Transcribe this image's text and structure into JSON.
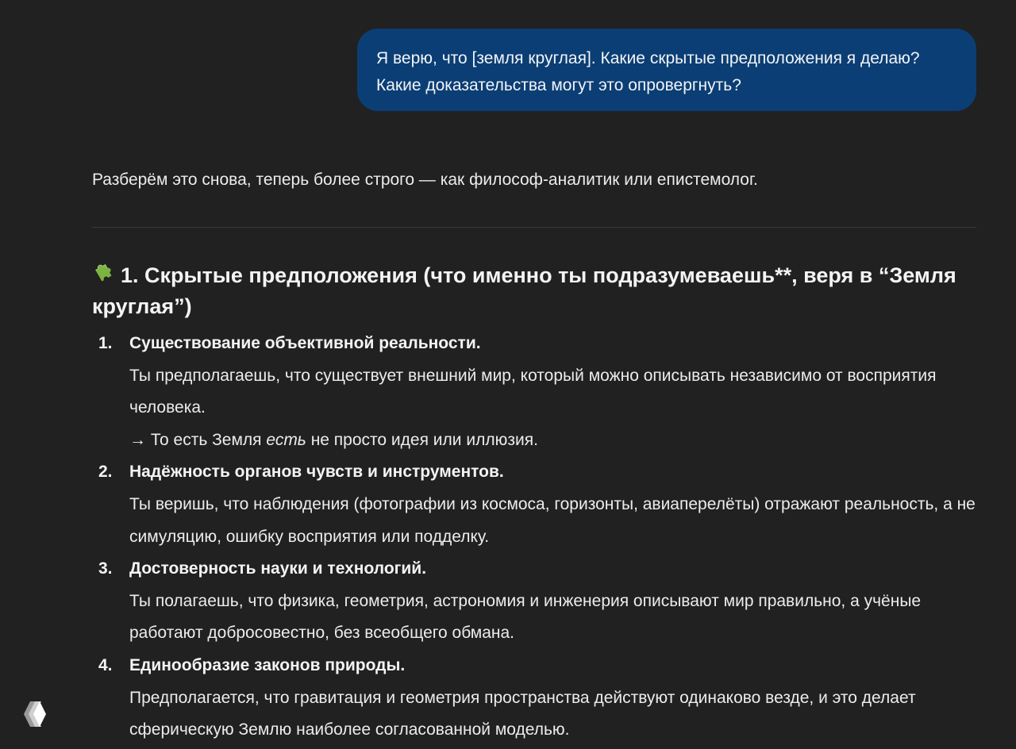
{
  "user_message": {
    "text": "Я верю, что [земля круглая]. Какие скрытые предположения я делаю? Какие доказательства могут это опровергнуть?"
  },
  "assistant": {
    "intro": "Разберём это снова, теперь более строго — как философ-аналитик или епистемолог.",
    "section": {
      "icon": "puzzle-icon",
      "title": "1. Скрытые предположения (что именно ты подразумеваешь**, веря в “Земля круглая”)"
    },
    "items": [
      {
        "number": "1.",
        "heading": "Существование объективной реальности.",
        "body": "Ты предполагаешь, что существует внешний мир, который можно описывать независимо от восприятия человека.",
        "extra_prefix": "→ То есть Земля ",
        "extra_em": "есть",
        "extra_suffix": " не просто идея или иллюзия."
      },
      {
        "number": "2.",
        "heading": "Надёжность органов чувств и инструментов.",
        "body": "Ты веришь, что наблюдения (фотографии из космоса, горизонты, авиаперелёты) отражают реальность, а не симуляцию, ошибку восприятия или подделку."
      },
      {
        "number": "3.",
        "heading": "Достоверность науки и технологий.",
        "body": "Ты полагаешь, что физика, геометрия, астрономия и инженерия описывают мир правильно, а учёные работают добросовестно, без всеобщего обмана."
      },
      {
        "number": "4.",
        "heading": "Единообразие законов природы.",
        "body": "Предполагается, что гравитация и геометрия пространства действуют одинаково везде, и это делает сферическую Землю наиболее согласованной моделью."
      }
    ]
  },
  "colors": {
    "background": "#212121",
    "user_bubble": "#0b3e74",
    "puzzle_icon": "#7cb342",
    "text": "#ececec"
  },
  "logo_icon": "app-logo-icon"
}
